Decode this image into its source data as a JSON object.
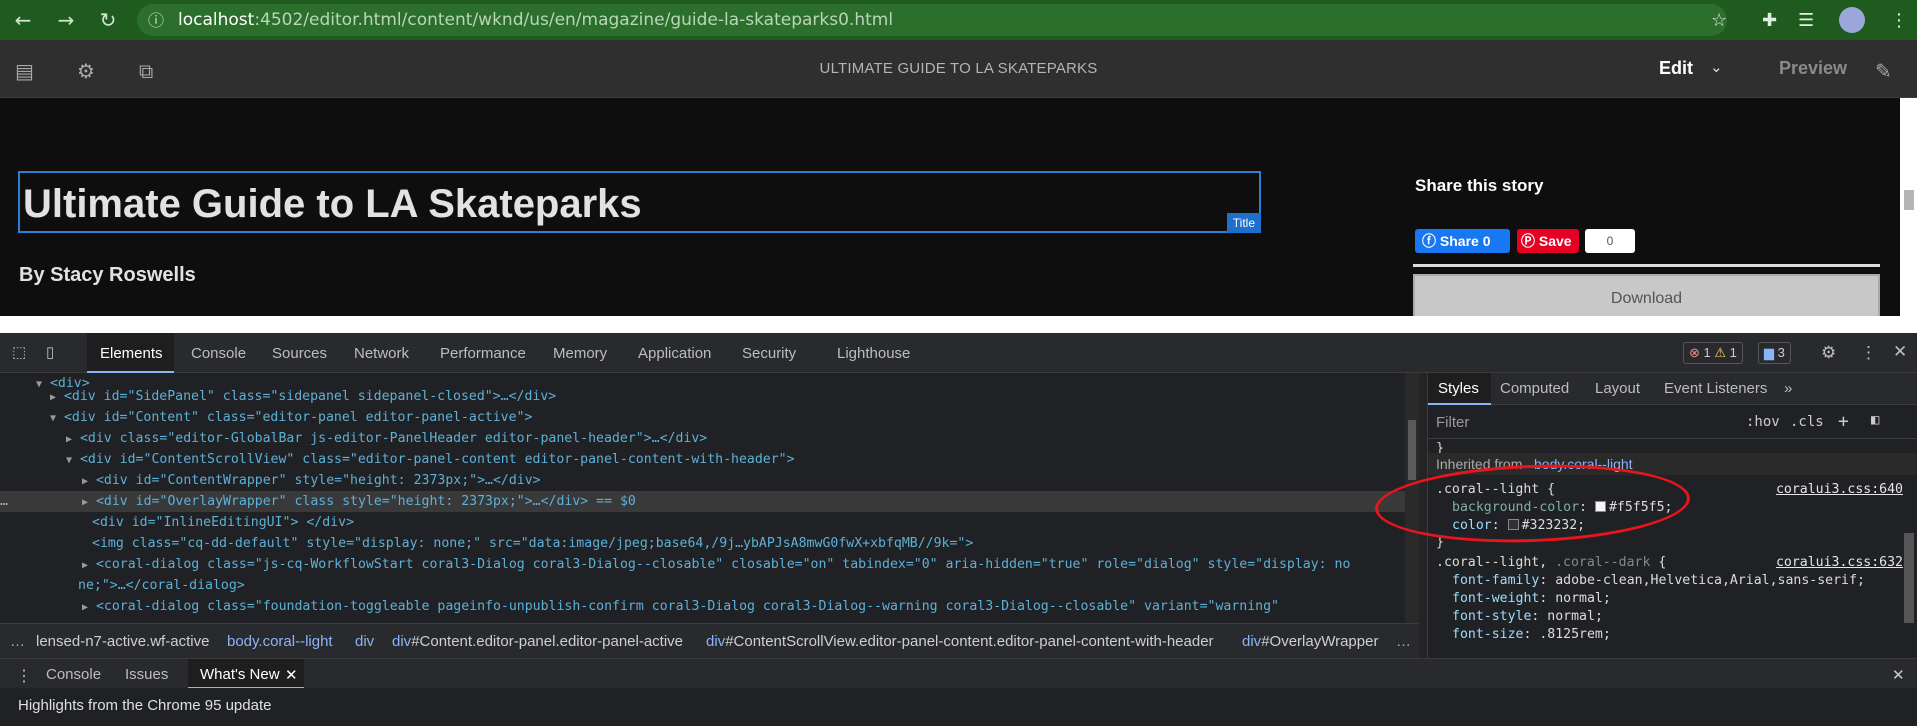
{
  "browser": {
    "url_host": "localhost",
    "url_rest": ":4502/editor.html/content/wknd/us/en/magazine/guide-la-skateparks0.html",
    "icons": [
      "back-icon",
      "forward-icon",
      "reload-icon",
      "info-icon",
      "star-icon",
      "extensions-icon",
      "reading-list-icon",
      "profile-avatar"
    ]
  },
  "editor": {
    "page_title": "ULTIMATE GUIDE TO LA SKATEPARKS",
    "mode_label": "Edit",
    "preview_label": "Preview"
  },
  "page": {
    "article_title": "Ultimate Guide to LA Skateparks",
    "title_badge": "Title",
    "byline": "By Stacy Roswells",
    "share_title": "Share this story",
    "facebook_label": "Share 0",
    "pinterest_label": "Save",
    "pinterest_count": "0",
    "download_label": "Download"
  },
  "devtools": {
    "tabs": [
      "Elements",
      "Console",
      "Sources",
      "Network",
      "Performance",
      "Memory",
      "Application",
      "Security",
      "Lighthouse"
    ],
    "error_count": "1",
    "warning_count": "1",
    "message_count": "3",
    "dom_lines": [
      {
        "text": "<div>"
      },
      {
        "text": "<div id=\"SidePanel\" class=\"sidepanel sidepanel-closed\">…</div>"
      },
      {
        "text": "<div id=\"Content\" class=\"editor-panel editor-panel-active\">"
      },
      {
        "text": "<div class=\"editor-GlobalBar js-editor-PanelHeader editor-panel-header\">…</div>"
      },
      {
        "text": "<div id=\"ContentScrollView\" class=\"editor-panel-content editor-panel-content-with-header\">"
      },
      {
        "text": "<div id=\"ContentWrapper\" style=\"height: 2373px;\">…</div>"
      },
      {
        "text": "<div id=\"OverlayWrapper\" class style=\"height: 2373px;\">…</div> == $0"
      },
      {
        "text": "<div id=\"InlineEditingUI\"> </div>"
      },
      {
        "text": "<img class=\"cq-dd-default\" style=\"display: none;\" src=\"data:image/jpeg;base64,/9j…ybAPJsA8mwG0fwX+xbfqMB//9k=\">"
      },
      {
        "text": "<coral-dialog class=\"js-cq-WorkflowStart coral3-Dialog coral3-Dialog--closable\" closable=\"on\" tabindex=\"0\" aria-hidden=\"true\" role=\"dialog\" style=\"display: no"
      },
      {
        "text": "ne;\">…</coral-dialog>"
      },
      {
        "text": "<coral-dialog class=\"foundation-toggleable pageinfo-unpublish-confirm coral3-Dialog coral3-Dialog--warning coral3-Dialog--closable\" variant=\"warning\""
      }
    ],
    "breadcrumbs": [
      {
        "pre": "lensed-n7-active.wf-active",
        "n": ""
      },
      {
        "pre": "body.coral--light",
        "n": ""
      },
      {
        "pre": "div",
        "n": ""
      },
      {
        "pre": "div",
        "n": "#Content.editor-panel.editor-panel-active"
      },
      {
        "pre": "div",
        "n": "#ContentScrollView.editor-panel-content.editor-panel-content-with-header"
      },
      {
        "pre": "div",
        "n": "#OverlayWrapper"
      }
    ],
    "styles": {
      "tabs": [
        "Styles",
        "Computed",
        "Layout",
        "Event Listeners"
      ],
      "filter_placeholder": "Filter",
      "hov": ":hov",
      "cls": ".cls",
      "inherited_label": "Inherited from",
      "inherited_selector": "body.coral--light",
      "rule1": {
        "selector": ".coral--light {",
        "source": "coralui3.css:640",
        "decls": [
          {
            "prop": "background-color",
            "value": "#f5f5f5",
            "swatch": "#f5f5f5"
          },
          {
            "prop": "color",
            "value": "#323232",
            "swatch": "#323232"
          }
        ]
      },
      "rule2": {
        "selector_main": ".coral--light,",
        "selector_dim": ".coral--dark",
        "source": "coralui3.css:632",
        "decls": [
          {
            "prop": "font-family",
            "value": "adobe-clean,Helvetica,Arial,sans-serif"
          },
          {
            "prop": "font-weight",
            "value": "normal"
          },
          {
            "prop": "font-style",
            "value": "normal"
          },
          {
            "prop": "font-size",
            "value": ".8125rem"
          }
        ]
      }
    },
    "drawer": {
      "tabs": [
        "Console",
        "Issues",
        "What's New"
      ],
      "highlights": "Highlights from the Chrome 95 update"
    }
  },
  "colors": {
    "browser_bar": "#1f5a1f",
    "selection_blue": "#2d7fd3",
    "annotation_red": "#e8161c"
  }
}
